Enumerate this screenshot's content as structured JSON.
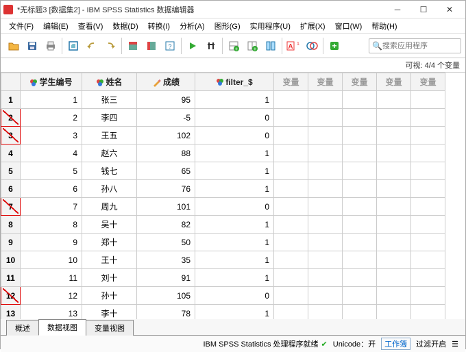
{
  "window": {
    "title": "*无标题3 [数据集2] - IBM SPSS Statistics 数据编辑器"
  },
  "menu": {
    "items": [
      "文件(F)",
      "编辑(E)",
      "查看(V)",
      "数据(D)",
      "转换(I)",
      "分析(A)",
      "图形(G)",
      "实用程序(U)",
      "扩展(X)",
      "窗口(W)",
      "帮助(H)"
    ]
  },
  "search": {
    "placeholder": "搜索应用程序"
  },
  "visibility": {
    "text": "可视: 4/4 个变量"
  },
  "columns": {
    "id": {
      "label": "学生编号",
      "icon_color": "#e8a23a"
    },
    "name": {
      "label": "姓名",
      "icon_color": "#d44"
    },
    "score": {
      "label": "成绩",
      "icon_type": "pencil"
    },
    "filter": {
      "label": "filter_$",
      "icon_color": "#e8a23a"
    },
    "var": {
      "label": "变量"
    }
  },
  "rows": [
    {
      "n": 1,
      "id": 1,
      "name": "张三",
      "score": 95,
      "filter": 1,
      "filtered": false
    },
    {
      "n": 2,
      "id": 2,
      "name": "李四",
      "score": -5,
      "filter": 0,
      "filtered": true
    },
    {
      "n": 3,
      "id": 3,
      "name": "王五",
      "score": 102,
      "filter": 0,
      "filtered": true
    },
    {
      "n": 4,
      "id": 4,
      "name": "赵六",
      "score": 88,
      "filter": 1,
      "filtered": false
    },
    {
      "n": 5,
      "id": 5,
      "name": "钱七",
      "score": 65,
      "filter": 1,
      "filtered": false
    },
    {
      "n": 6,
      "id": 6,
      "name": "孙八",
      "score": 76,
      "filter": 1,
      "filtered": false
    },
    {
      "n": 7,
      "id": 7,
      "name": "周九",
      "score": 101,
      "filter": 0,
      "filtered": true
    },
    {
      "n": 8,
      "id": 8,
      "name": "吴十",
      "score": 82,
      "filter": 1,
      "filtered": false
    },
    {
      "n": 9,
      "id": 9,
      "name": "郑十",
      "score": 50,
      "filter": 1,
      "filtered": false
    },
    {
      "n": 10,
      "id": 10,
      "name": "王十",
      "score": 35,
      "filter": 1,
      "filtered": false
    },
    {
      "n": 11,
      "id": 11,
      "name": "刘十",
      "score": 91,
      "filter": 1,
      "filtered": false
    },
    {
      "n": 12,
      "id": 12,
      "name": "孙十",
      "score": 105,
      "filter": 0,
      "filtered": true
    },
    {
      "n": 13,
      "id": 13,
      "name": "李十",
      "score": 78,
      "filter": 1,
      "filtered": false
    }
  ],
  "tabs": {
    "items": [
      "概述",
      "数据视图",
      "变量视图"
    ],
    "active": 1
  },
  "status": {
    "processor": "IBM SPSS Statistics 处理程序就绪",
    "unicode": "Unicode：开",
    "workbook": "工作簿",
    "filter": "过滤开启"
  }
}
